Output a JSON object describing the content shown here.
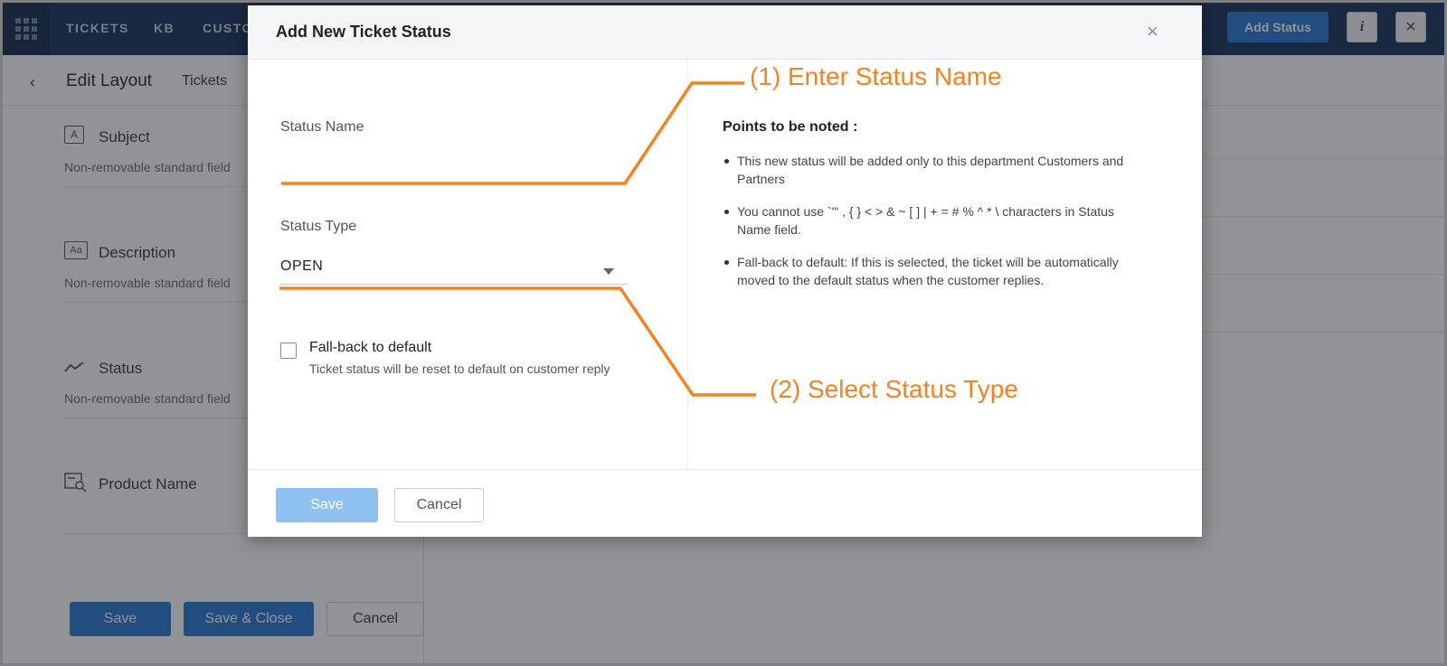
{
  "app": {
    "nav_items": [
      "TICKETS",
      "KB",
      "CUSTO"
    ],
    "top_right": {
      "add_status_label": "Add Status",
      "info_icon": "info-icon",
      "info_glyph": "i",
      "close_glyph": "×"
    }
  },
  "subheader": {
    "back_glyph": "‹",
    "title": "Edit Layout",
    "breadcrumb": "Tickets"
  },
  "left_fields": [
    {
      "name": "Subject",
      "sub": "Non-removable standard field",
      "icon": "text-field-icon",
      "glyph": "A"
    },
    {
      "name": "Description",
      "sub": "Non-removable standard field",
      "icon": "textarea-icon",
      "glyph": "Aa"
    },
    {
      "name": "Status",
      "sub": "Non-removable standard field",
      "icon": "status-trend-icon",
      "glyph": ""
    },
    {
      "name": "Product Name",
      "sub": "",
      "icon": "lookup-icon",
      "glyph": ""
    }
  ],
  "layout_buttons": {
    "save": "Save",
    "save_close": "Save & Close",
    "cancel": "Cancel"
  },
  "modal": {
    "title": "Add New Ticket Status",
    "close_glyph": "×",
    "status_name_label": "Status Name",
    "status_name_value": "",
    "status_type_label": "Status Type",
    "status_type_value": "OPEN",
    "fallback_label": "Fall-back to default",
    "fallback_sub": "Ticket status will be reset to default on customer reply",
    "fallback_checked": false,
    "notes_title": "Points to be noted :",
    "notes": [
      "This new status will be added only to this department Customers and Partners",
      "You cannot use `'\" , { } < > & ~ [ ] | + = # % ^ * \\ characters in Status Name field.",
      "Fall-back to default: If this is selected, the ticket will be automatically moved to the default status when the customer replies."
    ],
    "save_label": "Save",
    "cancel_label": "Cancel"
  },
  "annotations": {
    "step1": "(1) Enter Status Name",
    "step2": "(2) Select Status Type",
    "color": "#f6821f"
  },
  "colors": {
    "nav_bg": "#0d2a52",
    "accent": "#1e73d2",
    "save_disabled": "#8ec1f2"
  }
}
